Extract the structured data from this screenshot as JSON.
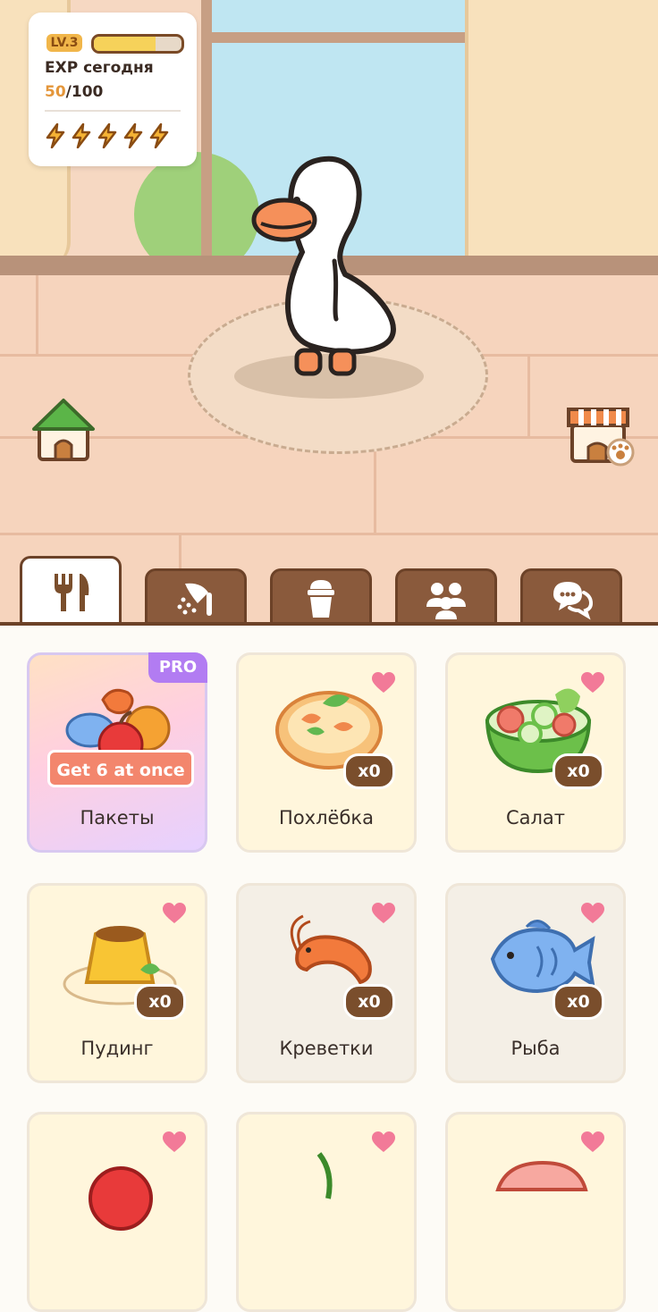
{
  "status": {
    "level_badge": "LV.3",
    "level_progress": 0.7,
    "exp_title": "EXP сегодня",
    "exp_current": "50",
    "exp_max": "/100",
    "energy_bolts": 5
  },
  "scene": {
    "left_button_icon": "house-icon",
    "right_button_icon": "shop-icon"
  },
  "tabs": [
    {
      "icon": "fork-knife-icon",
      "active": true
    },
    {
      "icon": "shower-icon",
      "active": false
    },
    {
      "icon": "cup-icon",
      "active": false
    },
    {
      "icon": "friends-icon",
      "active": false
    },
    {
      "icon": "chat-icon",
      "active": false
    }
  ],
  "items": [
    {
      "label": "Пакеты",
      "badge": "PRO",
      "ribbon": "Get 6 at once"
    },
    {
      "label": "Похлёбка",
      "count": "x0"
    },
    {
      "label": "Салат",
      "count": "x0"
    },
    {
      "label": "Пудинг",
      "count": "x0"
    },
    {
      "label": "Креветки",
      "count": "x0"
    },
    {
      "label": "Рыба",
      "count": "x0"
    }
  ],
  "colors": {
    "accent_brown": "#7a4e2c",
    "tab_brown": "#8a5a3c",
    "heart_pink": "#f27a98",
    "pro_purple": "#b27cf2",
    "exp_orange": "#e4963a"
  }
}
